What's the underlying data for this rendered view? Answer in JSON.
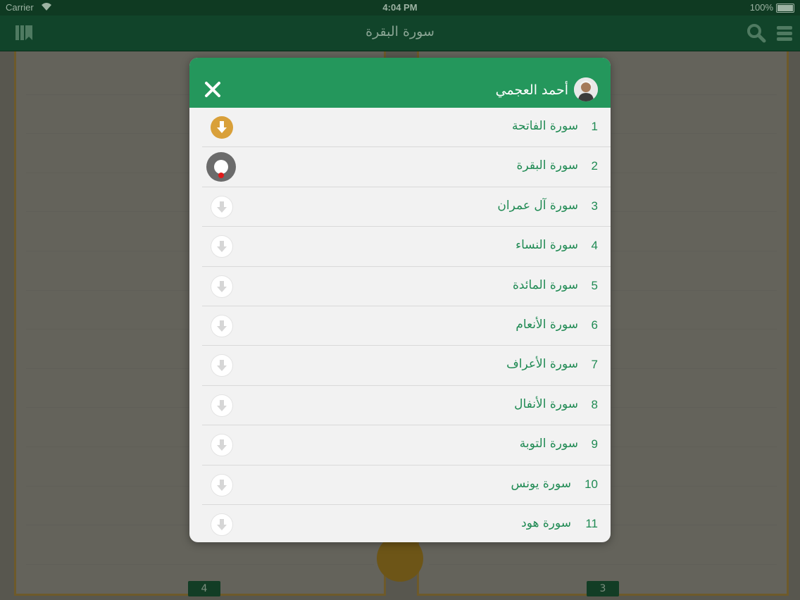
{
  "status_bar": {
    "carrier": "Carrier",
    "time": "4:04 PM",
    "battery": "100%"
  },
  "nav": {
    "title": "سورة البقرة"
  },
  "pages": {
    "left_number": "4",
    "right_number": "3"
  },
  "modal": {
    "reciter": "أحمد العجمي",
    "surahs": [
      {
        "number": "1",
        "name": "سورة الفاتحة",
        "state": "downloaded"
      },
      {
        "number": "2",
        "name": "سورة البقرة",
        "state": "downloading"
      },
      {
        "number": "3",
        "name": "سورة آل عمران",
        "state": "available"
      },
      {
        "number": "4",
        "name": "سورة النساء",
        "state": "available"
      },
      {
        "number": "5",
        "name": "سورة المائدة",
        "state": "available"
      },
      {
        "number": "6",
        "name": "سورة الأنعام",
        "state": "available"
      },
      {
        "number": "7",
        "name": "سورة الأعراف",
        "state": "available"
      },
      {
        "number": "8",
        "name": "سورة الأنفال",
        "state": "available"
      },
      {
        "number": "9",
        "name": "سورة التوبة",
        "state": "available"
      },
      {
        "number": "10",
        "name": "سورة يونس",
        "state": "available"
      },
      {
        "number": "11",
        "name": "سورة هود",
        "state": "available"
      }
    ]
  },
  "colors": {
    "header_green": "#24975c",
    "text_green": "#1f8a53",
    "downloaded_gold": "#d9a03a"
  },
  "icons": {
    "nav": [
      "bookmarks-icon",
      "search-icon",
      "menu-icon"
    ],
    "modal": [
      "close-icon",
      "reciter-avatar",
      "download-icon"
    ]
  }
}
